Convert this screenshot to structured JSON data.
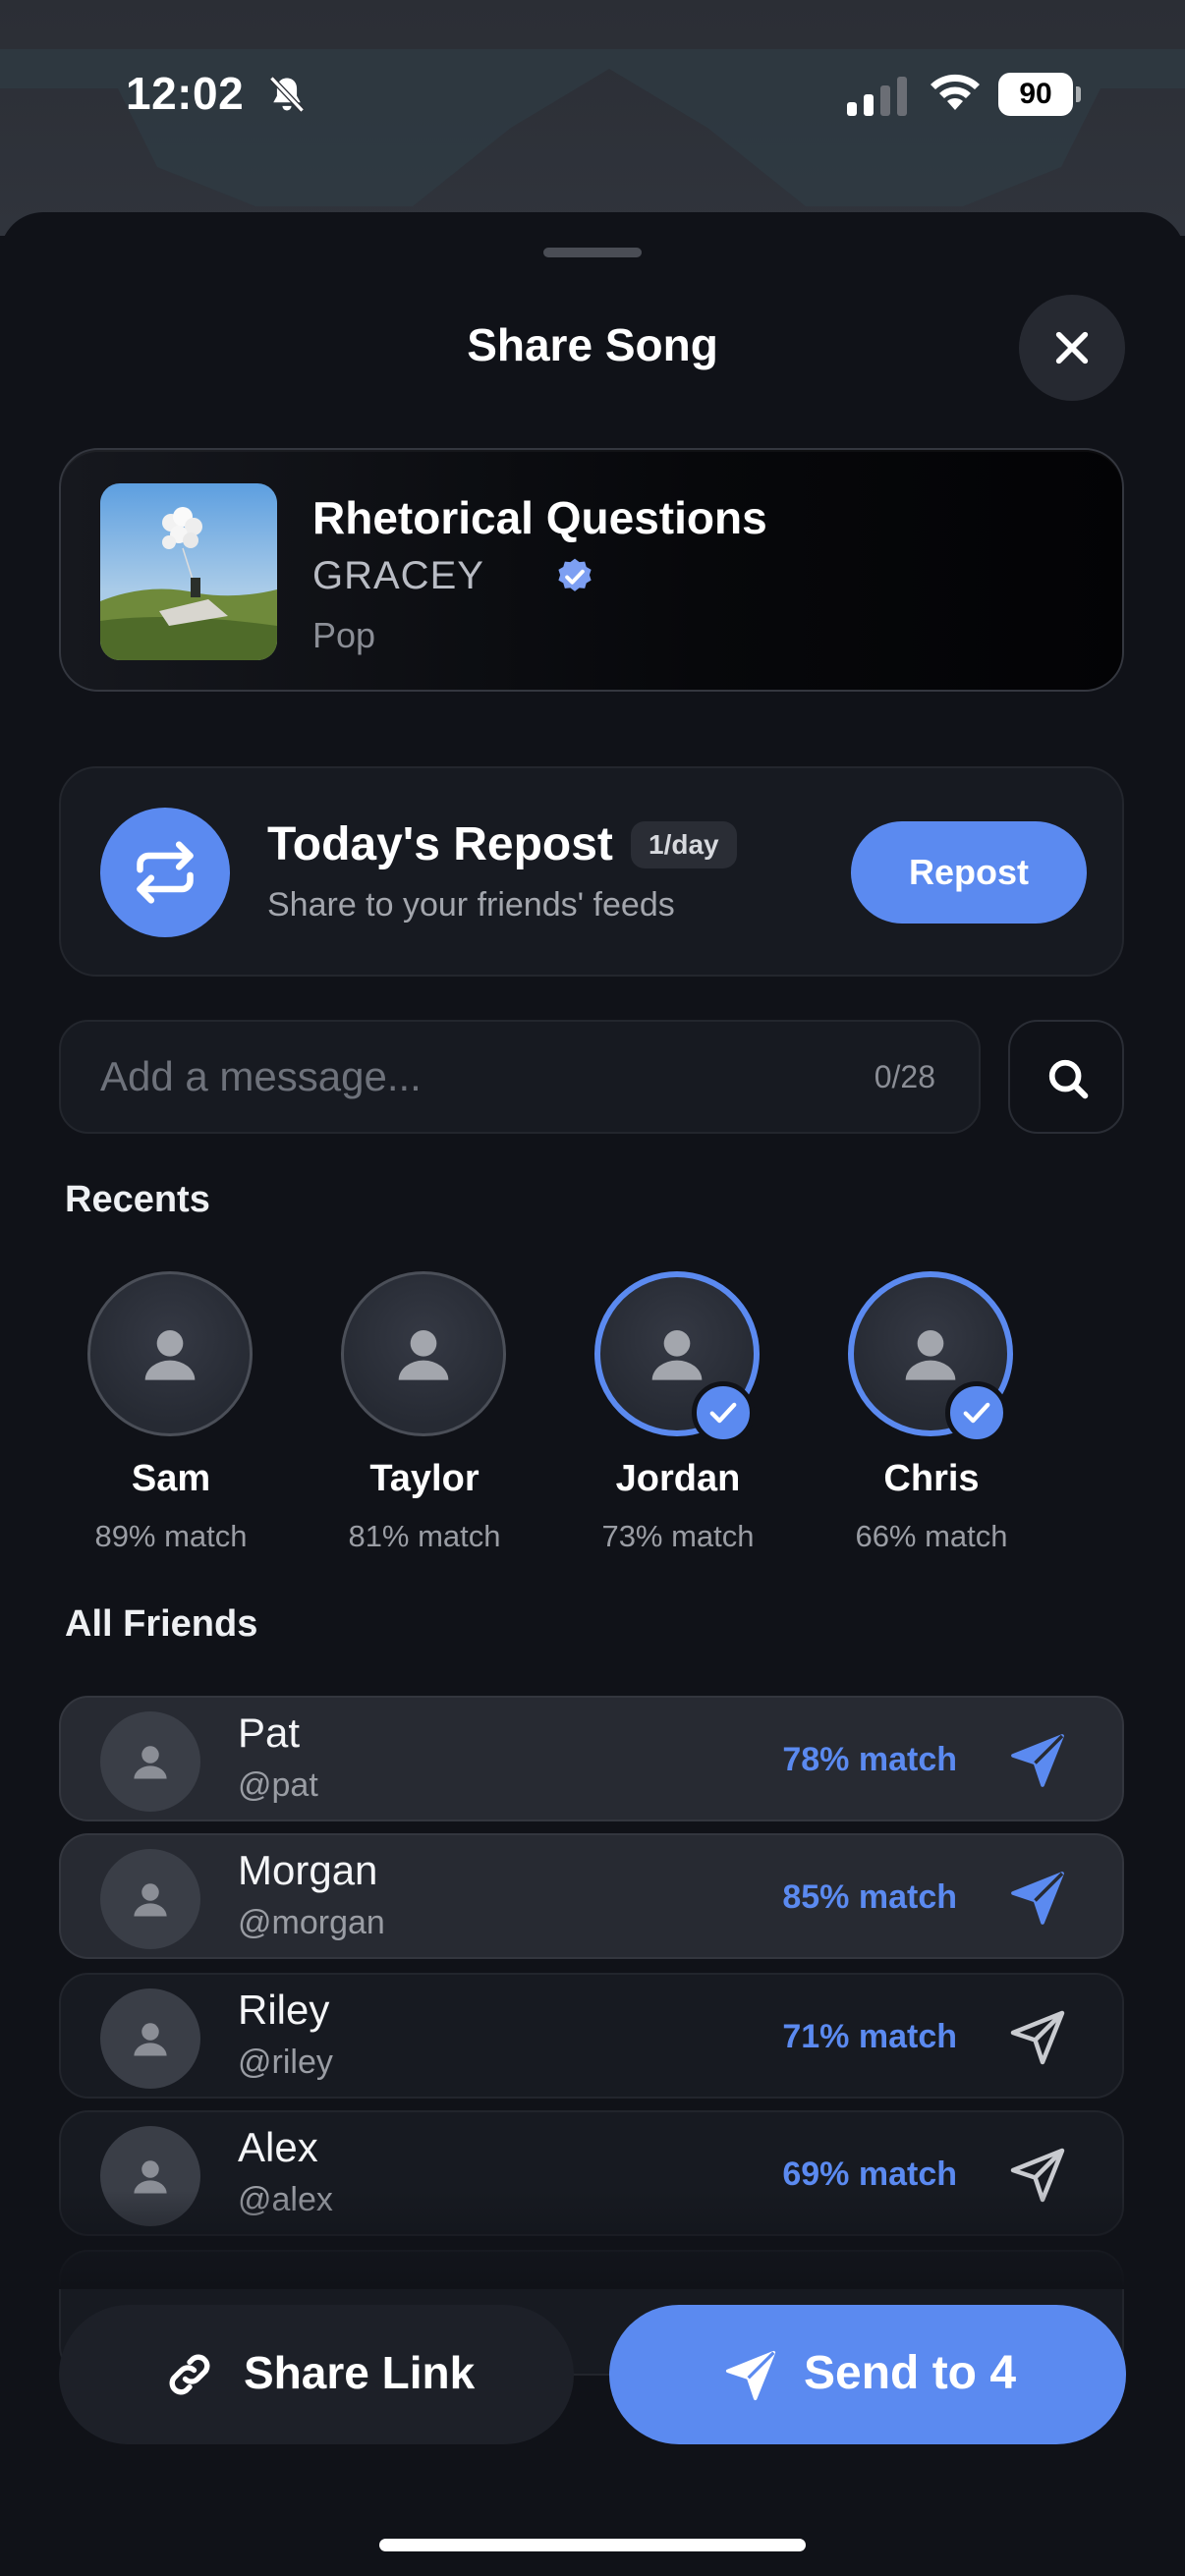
{
  "status_bar": {
    "time": "12:02",
    "battery": "90"
  },
  "sheet": {
    "title": "Share Song"
  },
  "song": {
    "title": "Rhetorical Questions",
    "artist": "GRACEY",
    "genre": "Pop"
  },
  "repost": {
    "title": "Today's Repost",
    "badge": "1/day",
    "subtitle": "Share to your friends' feeds",
    "button": "Repost"
  },
  "message": {
    "placeholder": "Add a message...",
    "counter": "0/28"
  },
  "recents": {
    "label": "Recents",
    "items": [
      {
        "name": "Sam",
        "match": "89% match",
        "selected": false
      },
      {
        "name": "Taylor",
        "match": "81% match",
        "selected": false
      },
      {
        "name": "Jordan",
        "match": "73% match",
        "selected": true
      },
      {
        "name": "Chris",
        "match": "66% match",
        "selected": true
      }
    ]
  },
  "friends": {
    "label": "All Friends",
    "items": [
      {
        "name": "Pat",
        "handle": "@pat",
        "match": "78% match",
        "selected": true
      },
      {
        "name": "Morgan",
        "handle": "@morgan",
        "match": "85% match",
        "selected": true
      },
      {
        "name": "Riley",
        "handle": "@riley",
        "match": "71% match",
        "selected": false
      },
      {
        "name": "Alex",
        "handle": "@alex",
        "match": "69% match",
        "selected": false
      }
    ]
  },
  "actions": {
    "share_link": "Share Link",
    "send": "Send to 4"
  },
  "colors": {
    "accent": "#5b8af0",
    "background": "#101218",
    "card": "#171a21"
  },
  "icons": [
    "bell-slash-icon",
    "signal-icon",
    "wifi-icon",
    "battery-icon",
    "close-icon",
    "verified-icon",
    "repost-icon",
    "search-icon",
    "person-icon",
    "check-icon",
    "send-icon",
    "link-icon"
  ]
}
